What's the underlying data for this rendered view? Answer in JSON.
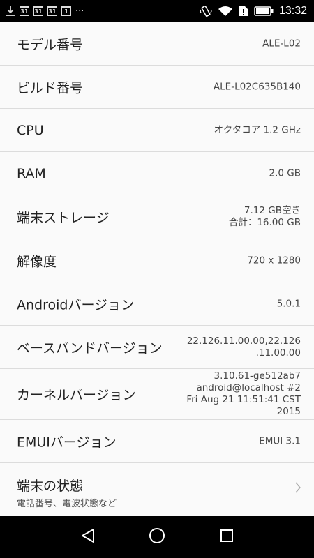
{
  "status_bar": {
    "left_icons": [
      "download-icon",
      "calendar-icon",
      "calendar-icon",
      "calendar-icon",
      "calendar-icon",
      "more-icon"
    ],
    "calendar_days": [
      "31",
      "31",
      "31",
      "1"
    ],
    "more": "···",
    "time": "13:32"
  },
  "rows": [
    {
      "label": "モデル番号",
      "value": "ALE-L02"
    },
    {
      "label": "ビルド番号",
      "value": "ALE-L02C635B140"
    },
    {
      "label": "CPU",
      "value": "オクタコア 1.2 GHz"
    },
    {
      "label": "RAM",
      "value": "2.0 GB"
    },
    {
      "label": "端末ストレージ",
      "value_lines": [
        "7.12  GB空き",
        "合計：16.00  GB"
      ]
    },
    {
      "label": "解像度",
      "value": "720 x 1280"
    },
    {
      "label": "Androidバージョン",
      "value": "5.0.1"
    },
    {
      "label": "ベースバンドバージョン",
      "value_lines": [
        "22.126.11.00.00,22.126",
        ".11.00.00"
      ]
    },
    {
      "label": "カーネルバージョン",
      "value_lines": [
        "3.10.61-ge512ab7",
        "android@localhost #2",
        "Fri Aug 21 11:51:41 CST",
        "2015"
      ]
    },
    {
      "label": "EMUIバージョン",
      "value": "EMUI 3.1"
    }
  ],
  "status_row": {
    "label": "端末の状態",
    "sub": "電話番号、電波状態など"
  },
  "nav": [
    "back-icon",
    "home-icon",
    "recents-icon"
  ]
}
